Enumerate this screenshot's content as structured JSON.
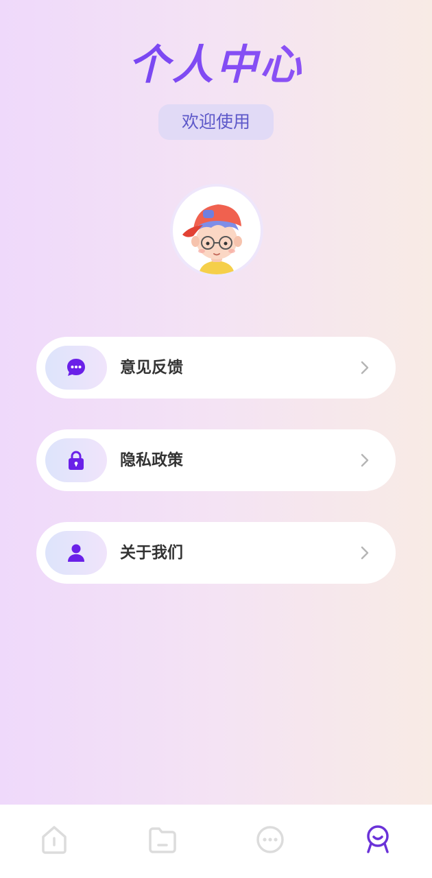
{
  "header": {
    "title": "个人中心",
    "welcome_badge": "欢迎使用"
  },
  "profile": {
    "avatar": "cartoon-boy-red-cap-avatar"
  },
  "menu": {
    "items": [
      {
        "label": "意见反馈",
        "icon": "chat-bubble-icon"
      },
      {
        "label": "隐私政策",
        "icon": "lock-icon"
      },
      {
        "label": "关于我们",
        "icon": "user-icon"
      }
    ]
  },
  "tab_bar": {
    "tabs": [
      {
        "icon": "home-icon",
        "active": false
      },
      {
        "icon": "folder-icon",
        "active": false
      },
      {
        "icon": "message-icon",
        "active": false
      },
      {
        "icon": "profile-icon",
        "active": true
      }
    ],
    "active_color": "#6a32d8",
    "inactive_color": "#dcdcdc"
  },
  "colors": {
    "accent": "#6a20e8",
    "chevron": "#b5b5b5"
  }
}
